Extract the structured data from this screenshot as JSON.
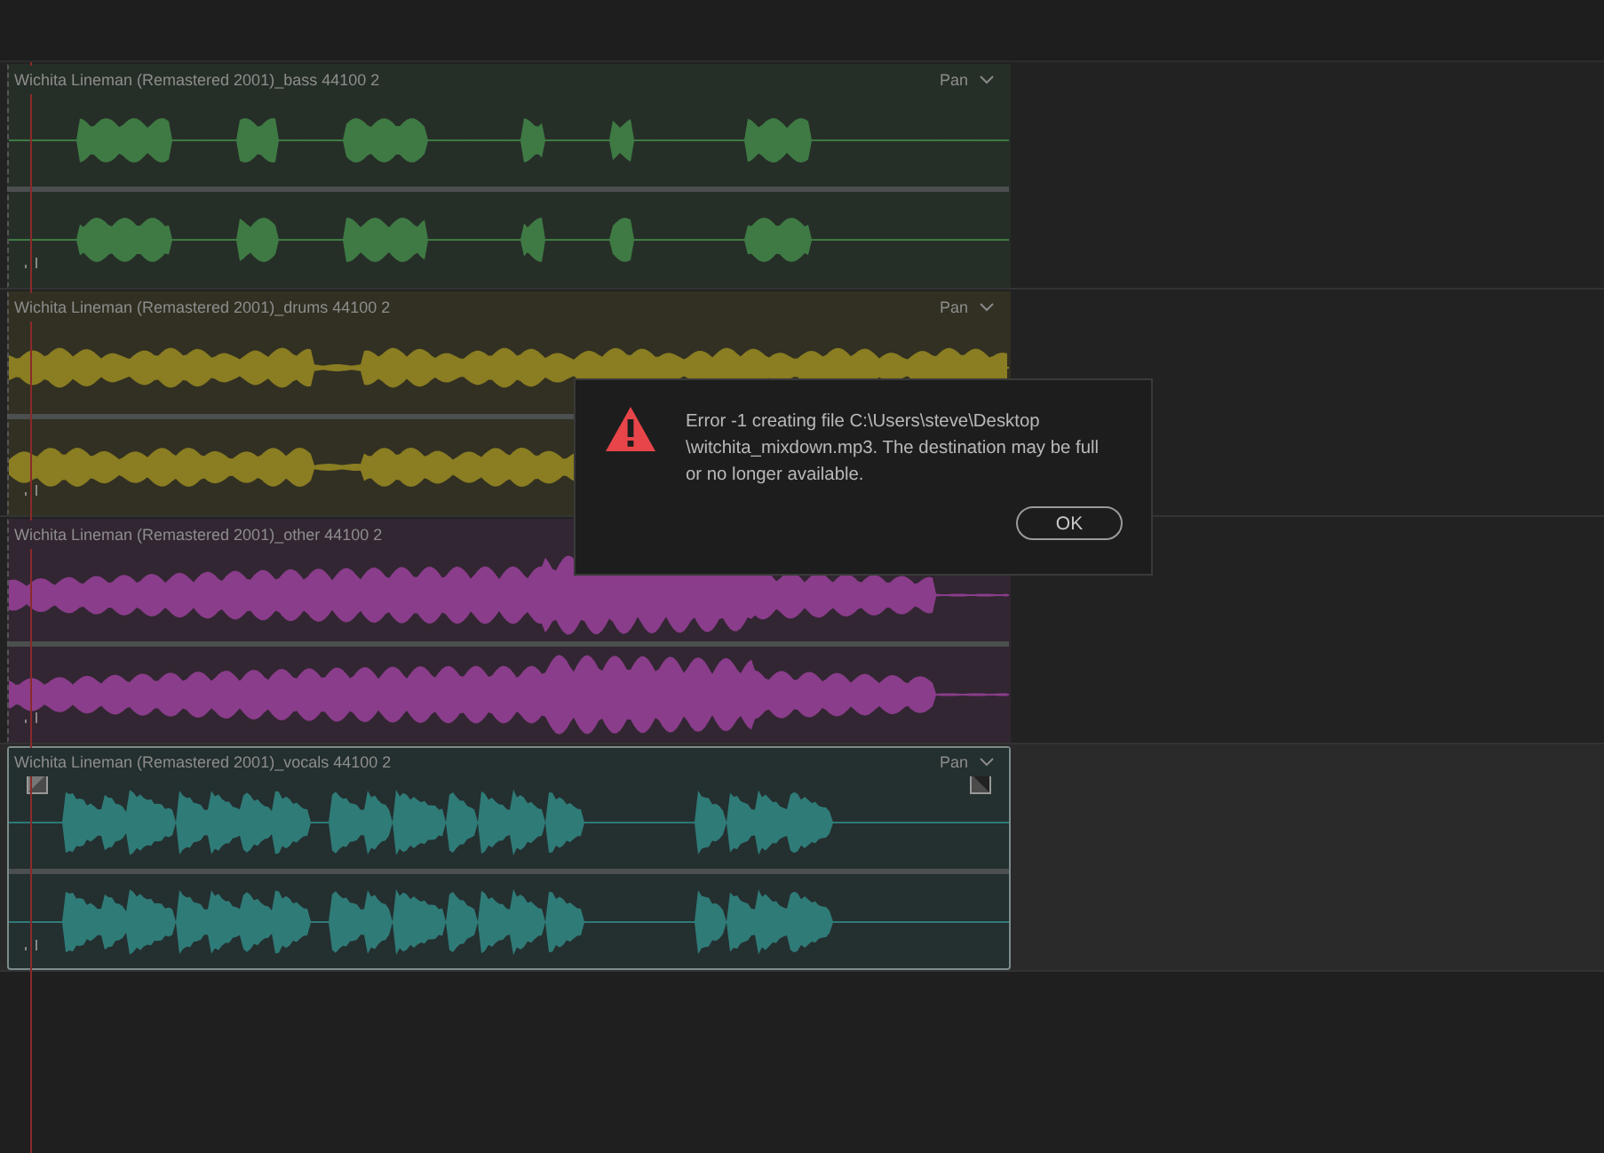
{
  "tracks": [
    {
      "clip": {
        "name": "Wichita Lineman (Remastered 2001)_bass 44100 2",
        "pan": "Pan",
        "color": "#3f7a45",
        "selected": false
      }
    },
    {
      "clip": {
        "name": "Wichita Lineman (Remastered 2001)_drums 44100 2",
        "pan": "Pan",
        "color": "#8a7d22",
        "selected": false
      }
    },
    {
      "clip": {
        "name": "Wichita Lineman (Remastered 2001)_other 44100 2",
        "color": "#8a3d8a",
        "selected": false
      }
    },
    {
      "clip": {
        "name": "Wichita Lineman (Remastered 2001)_vocals 44100 2",
        "pan": "Pan",
        "color": "#2f7b78",
        "selected": true
      }
    }
  ],
  "dialog": {
    "message": "Error -1 creating file C:\\Users\\steve\\Desktop \\witchita_mixdown.mp3.  The destination may be full or no longer available.",
    "button": "OK"
  }
}
